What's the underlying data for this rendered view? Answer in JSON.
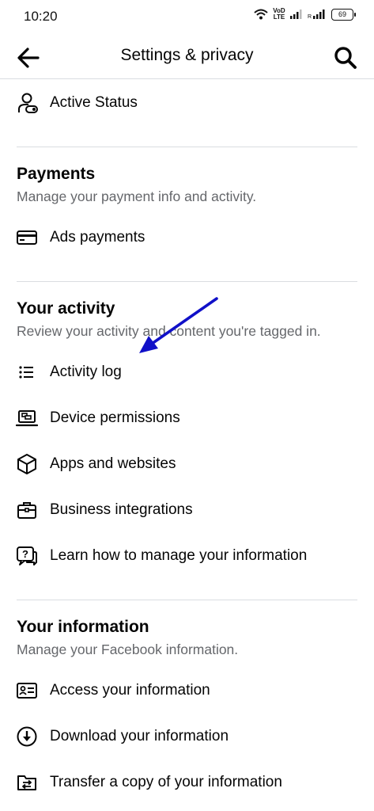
{
  "status_bar": {
    "time": "10:20",
    "network_label": "VoD LTE",
    "battery": "69"
  },
  "header": {
    "title": "Settings & privacy",
    "back_icon": "arrow-left-icon",
    "search_icon": "search-icon"
  },
  "top_item": {
    "label": "Active Status",
    "icon": "person-toggle-icon"
  },
  "payments": {
    "title": "Payments",
    "subtitle": "Manage your payment info and activity.",
    "items": [
      {
        "label": "Ads payments",
        "icon": "credit-card-icon"
      }
    ]
  },
  "your_activity": {
    "title": "Your activity",
    "subtitle": "Review your activity and content you're tagged in.",
    "items": [
      {
        "label": "Activity log",
        "icon": "list-icon"
      },
      {
        "label": "Device permissions",
        "icon": "laptop-icon"
      },
      {
        "label": "Apps and websites",
        "icon": "cube-icon"
      },
      {
        "label": "Business integrations",
        "icon": "briefcase-icon"
      },
      {
        "label": "Learn how to manage your information",
        "icon": "question-chat-icon"
      }
    ]
  },
  "your_information": {
    "title": "Your information",
    "subtitle": "Manage your Facebook information.",
    "items": [
      {
        "label": "Access your information",
        "icon": "id-card-icon"
      },
      {
        "label": "Download your information",
        "icon": "download-circle-icon"
      },
      {
        "label": "Transfer a copy of your information",
        "icon": "folder-transfer-icon"
      }
    ]
  },
  "annotation": {
    "arrow_color": "#1010c8"
  }
}
